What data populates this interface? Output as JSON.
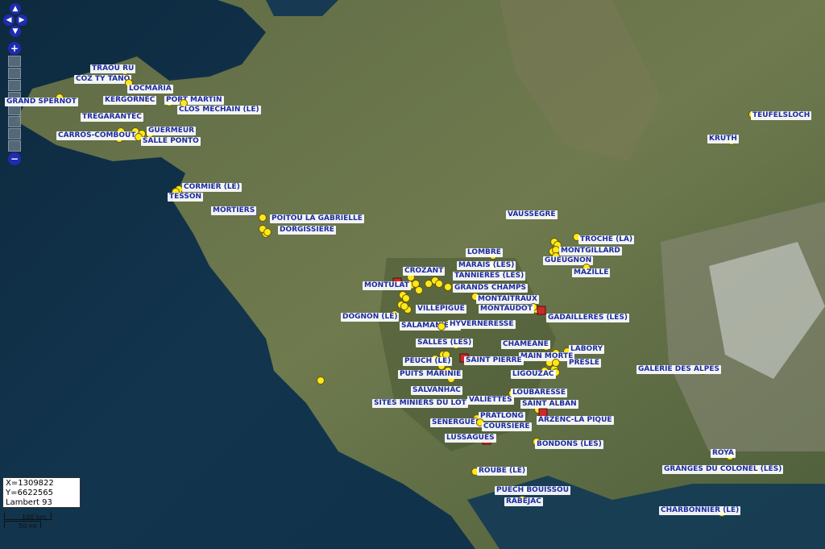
{
  "controls": {
    "pan": {
      "up": "▲",
      "down": "▼",
      "left": "◀",
      "right": "▶"
    },
    "zoom_in": "+",
    "zoom_out": "−",
    "zoom_levels": 8
  },
  "coordinates": {
    "x": "X=1309822",
    "y": "Y=6622565",
    "projection": "Lambert 93"
  },
  "scale": {
    "top": "100 km",
    "bottom": "50 mi"
  },
  "colors": {
    "pin": "#ffe81a",
    "label_text": "#1a2aa0",
    "flag": "#cc2a2a",
    "triangle": "#5a3fd0"
  },
  "labels": [
    "TRAOU RU",
    "COZ TY TANO",
    "LOCMARIA",
    "KERGORNEC",
    "GRAND SPERNOT",
    "PORT MARTIN",
    "CLOS MECHAIN (LE)",
    "TREGARANTEC",
    "GUERMEUR",
    "CARROS-COMBOUT",
    "SALLE PONTO",
    "CORMIER (LE)",
    "TESSON",
    "MORTIERS",
    "POITOU LA GABRIELLE",
    "DORGISSIERE",
    "TEUFELSLOCH",
    "KRUTH",
    "VAUSSEGRE",
    "TROCHE (LA)",
    "MONTGILLARD",
    "GUEUGNON",
    "MAZILLE",
    "LOMBRE",
    "MARAIS (LES)",
    "CROZANT",
    "TANNIERES (LES)",
    "MONTULAT",
    "GRANDS CHAMPS",
    "MONTAITRAUX",
    "MONTAUDOT",
    "GADAILLERES (LES)",
    "VILLEPIGUE",
    "DOGNON (LE)",
    "SALAMANIERE",
    "HYVERNERESSE",
    "SALLES (LES)",
    "CHAMEANE",
    "LABORY",
    "MAIN MORTE",
    "PRESLE",
    "SAINT PIERRE",
    "PEUCH (LE)",
    "LIGOUZAC",
    "GALERIE DES ALPES",
    "PUITS MARINIE",
    "SALVANHAC",
    "LOUBARESSE",
    "VALIETTES",
    "SAINT ALBAN",
    "SITES MINIERS DU LOT",
    "PRATLONG",
    "SENERGUES",
    "COURSIERE",
    "ARZENC-LA PIQUE",
    "LUSSAGUES",
    "BONDONS (LES)",
    "ROYA",
    "GRANGES DU COLONEL (LES)",
    "ROUBE (LE)",
    "PUECH BOUISSOU",
    "RABEJAC",
    "CHARBONNIER (LE)"
  ]
}
